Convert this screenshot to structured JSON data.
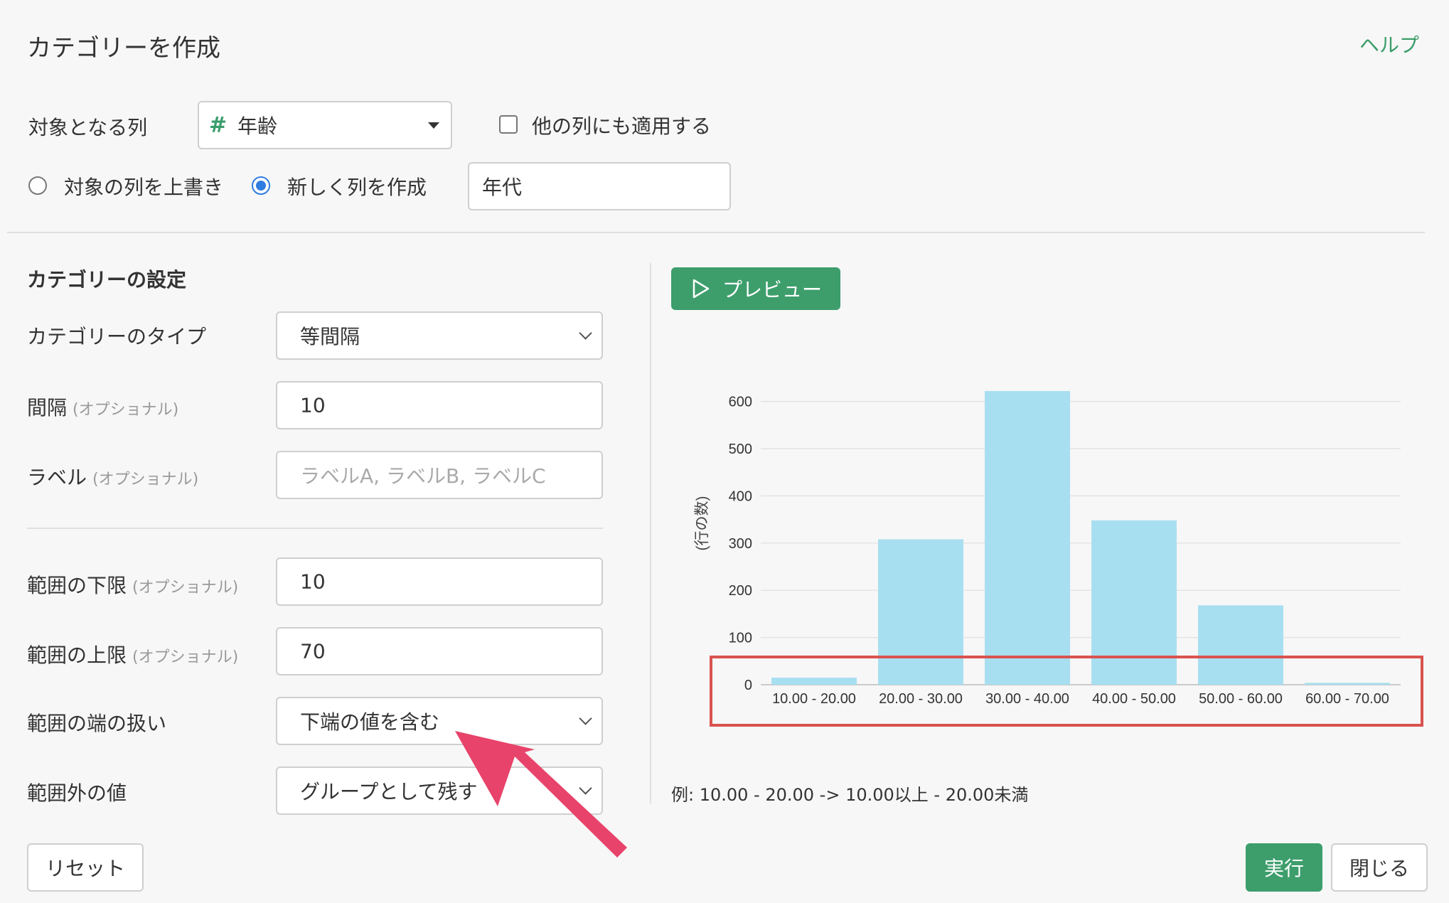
{
  "header": {
    "title": "カテゴリーを作成",
    "help_link": "ヘルプ"
  },
  "target": {
    "label": "対象となる列",
    "column_type_icon": "#",
    "column_value": "年齢",
    "apply_other_label": "他の列にも適用する",
    "apply_other_checked": false
  },
  "output": {
    "overwrite_label": "対象の列を上書き",
    "overwrite_selected": false,
    "new_column_label": "新しく列を作成",
    "new_column_selected": true,
    "new_column_name": "年代"
  },
  "settings": {
    "section_title": "カテゴリーの設定",
    "optional_tag": "(オプショナル)",
    "category_type": {
      "label": "カテゴリーのタイプ",
      "value": "等間隔"
    },
    "interval": {
      "label": "間隔",
      "value": "10"
    },
    "labels": {
      "label": "ラベル",
      "placeholder": "ラベルA, ラベルB, ラベルC"
    },
    "lower_bound": {
      "label": "範囲の下限",
      "value": "10"
    },
    "upper_bound": {
      "label": "範囲の上限",
      "value": "70"
    },
    "edge_handling": {
      "label": "範囲の端の扱い",
      "value": "下端の値を含む"
    },
    "out_of_range": {
      "label": "範囲外の値",
      "value": "グループとして残す"
    }
  },
  "preview": {
    "button_label": "プレビュー",
    "example_text": "例: 10.00 - 20.00 -> 10.00以上 - 20.00未満"
  },
  "footer": {
    "reset_label": "リセット",
    "run_label": "実行",
    "close_label": "閉じる"
  },
  "colors": {
    "accent_green": "#3d9e6c",
    "bar": "#a8dff0",
    "highlight_box": "#d9534f",
    "arrow": "#e8436a",
    "radio_blue": "#2f7de1"
  },
  "chart_data": {
    "type": "bar",
    "categories": [
      "10.00 - 20.00",
      "20.00 - 30.00",
      "30.00 - 40.00",
      "40.00 - 50.00",
      "50.00 - 60.00",
      "60.00 - 70.00"
    ],
    "values": [
      15,
      308,
      622,
      348,
      168,
      4
    ],
    "ylabel": "(行の数)",
    "yticks": [
      0,
      100,
      200,
      300,
      400,
      500,
      600
    ],
    "ylim": [
      0,
      640
    ],
    "grid": true
  }
}
